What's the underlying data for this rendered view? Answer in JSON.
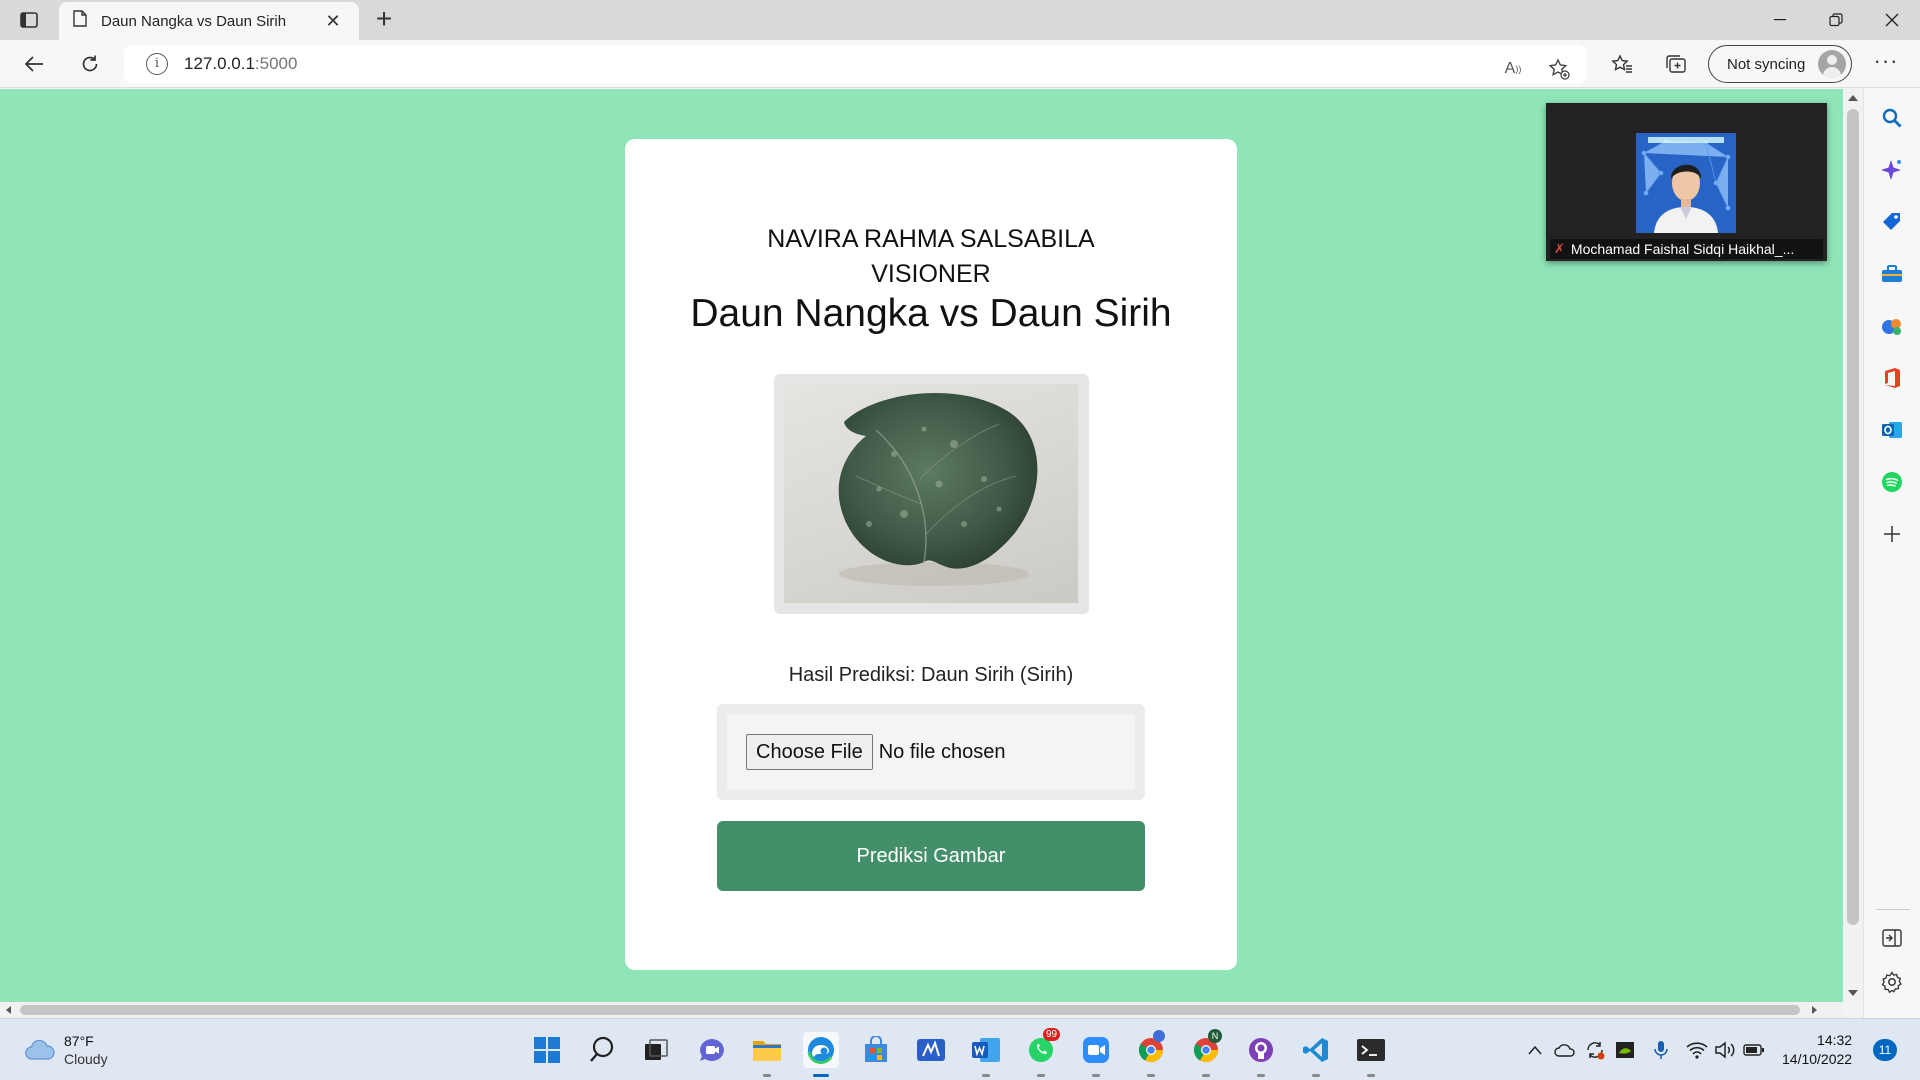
{
  "browser": {
    "tab_title": "Daun Nangka vs Daun Sirih",
    "address": {
      "host": "127.0.0.1",
      "port": ":5000"
    },
    "sync_label": "Not syncing"
  },
  "page": {
    "owner": "NAVIRA RAHMA SALSABILA",
    "team": "VISIONER",
    "heading": "Daun Nangka vs Daun Sirih",
    "result": "Hasil Prediksi: Daun Sirih (Sirih)",
    "file_button": "Choose File",
    "file_status": "No file chosen",
    "predict_button": "Prediksi Gambar",
    "background_color": "#8fe5b8",
    "button_color": "#428f6a"
  },
  "video_overlay": {
    "participant": "Mochamad Faishal Sidqi Haikhal_..."
  },
  "taskbar": {
    "temperature": "87°F",
    "condition": "Cloudy",
    "whatsapp_badge": "99",
    "chrome_badge": "N",
    "time": "14:32",
    "date": "14/10/2022",
    "notifications": "11"
  }
}
